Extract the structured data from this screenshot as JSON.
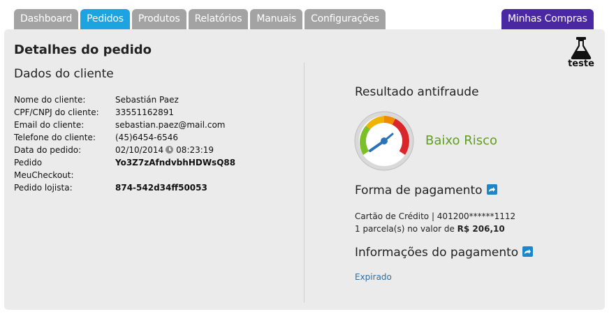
{
  "tabs": [
    {
      "label": "Dashboard",
      "active": false
    },
    {
      "label": "Pedidos",
      "active": true
    },
    {
      "label": "Produtos",
      "active": false
    },
    {
      "label": "Relatórios",
      "active": false
    },
    {
      "label": "Manuais",
      "active": false
    },
    {
      "label": "Configurações",
      "active": false
    }
  ],
  "buy_tab": "Minhas Compras",
  "page_title": "Detalhes do pedido",
  "badge": {
    "icon": "flask-icon",
    "label": "teste"
  },
  "client": {
    "title": "Dados do cliente",
    "name_label": "Nome do cliente:",
    "name": "Sebastián Paez",
    "cpf_label": "CPF/CNPJ do cliente:",
    "cpf": "33551162891",
    "email_label": "Email do cliente:",
    "email": "sebastian.paez@mail.com",
    "phone_label": "Telefone do cliente:",
    "phone": "(45)6454-6546",
    "date_label": "Data do pedido:",
    "date": "02/10/2014",
    "time": "08:23:19",
    "order_label_1": "Pedido",
    "order_label_2": "MeuCheckout:",
    "order_id": "Yo3Z7zAfndvbhHDWsQ88",
    "store_order_label": "Pedido lojista:",
    "store_order": "874-542d34ff50053"
  },
  "antifraud": {
    "title": "Resultado antifraude",
    "result": "Baixo Risco",
    "gauge_level": "low"
  },
  "payment": {
    "title": "Forma de pagamento",
    "card_line": "Cartão de Crédito | 401200******1112",
    "installments_prefix": "1 parcela(s) no valor de ",
    "amount": "R$ 206,10"
  },
  "payment_info": {
    "title": "Informações do pagamento",
    "status": "Expirado"
  },
  "colors": {
    "active_tab": "#1da3e0",
    "inactive_tab": "#a3a3a3",
    "buy_tab": "#4a27a3",
    "risk_green": "#5f9e1f",
    "link": "#2f6ea3"
  }
}
